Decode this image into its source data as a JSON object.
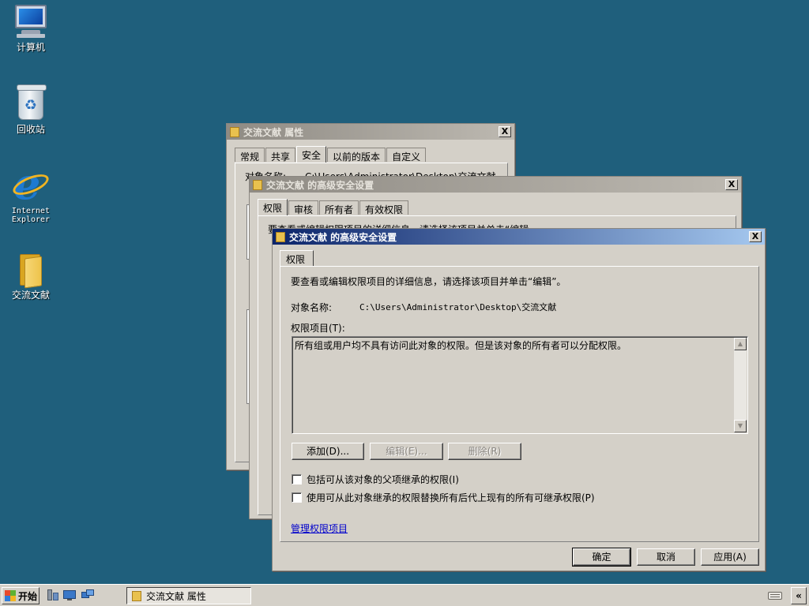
{
  "desktop": {
    "icons": [
      {
        "label": "计算机"
      },
      {
        "label": "回收站"
      },
      {
        "label": "Internet Explorer"
      },
      {
        "label": "交流文献"
      }
    ]
  },
  "properties_window": {
    "title": "交流文献 属性",
    "tabs": [
      "常规",
      "共享",
      "安全",
      "以前的版本",
      "自定义"
    ],
    "selected_tab": "安全",
    "object_name_label": "对象名称:",
    "object_name_value": "C:\\Users\\Administrator\\Desktop\\交流文献",
    "close_label": "X"
  },
  "advanced_window_back": {
    "title": "交流文献 的高级安全设置",
    "tabs": [
      "权限",
      "审核",
      "所有者",
      "有效权限"
    ],
    "selected_tab": "权限",
    "partial_text": "要查看或编辑权限项目的详细信息，请选择该项目并单击“编辑”。",
    "close_label": "X"
  },
  "advanced_window_front": {
    "title": "交流文献 的高级安全设置",
    "tab": "权限",
    "instruction": "要查看或编辑权限项目的详细信息，请选择该项目并单击“编辑”。",
    "object_name_label": "对象名称:",
    "object_name_value": "C:\\Users\\Administrator\\Desktop\\交流文献",
    "permission_entries_label": "权限项目(T):",
    "permission_entries_text": "所有组或用户均不具有访问此对象的权限。但是该对象的所有者可以分配权限。",
    "buttons": {
      "add": "添加(D)...",
      "edit": "编辑(E)...",
      "remove": "删除(R)"
    },
    "checkboxes": [
      {
        "label": "包括可从该对象的父项继承的权限(I)",
        "checked": false
      },
      {
        "label": "使用可从此对象继承的权限替换所有后代上现有的所有可继承权限(P)",
        "checked": false
      }
    ],
    "manage_link": "管理权限项目",
    "footer": {
      "ok": "确定",
      "cancel": "取消",
      "apply": "应用(A)"
    },
    "close_label": "X"
  },
  "taskbar": {
    "start_label": "开始",
    "task_button": "交流文献 属性",
    "tray_toggle": "«"
  },
  "colors": {
    "desktop": "#1f5f7c",
    "active_title": "#0b246a",
    "window_face": "#d4d0c8",
    "link": "#0000cc"
  }
}
